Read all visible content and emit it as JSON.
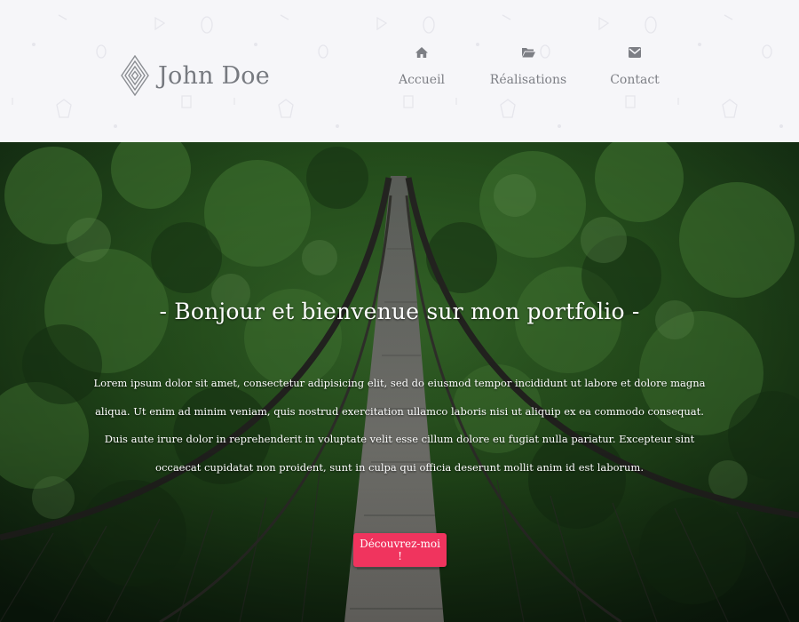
{
  "header": {
    "logo_text": "John Doe",
    "nav": [
      {
        "label": "Accueil",
        "icon": "home-icon"
      },
      {
        "label": "Réalisations",
        "icon": "folder-icon"
      },
      {
        "label": "Contact",
        "icon": "envelope-icon"
      }
    ]
  },
  "hero": {
    "title": "- Bonjour et bienvenue sur mon portfolio -",
    "text": "Lorem ipsum dolor sit amet, consectetur adipisicing elit, sed do eiusmod tempor incididunt ut labore et dolore magna aliqua. Ut enim ad minim veniam, quis nostrud exercitation ullamco laboris nisi ut aliquip ex ea commodo consequat. Duis aute irure dolor in reprehenderit in voluptate velit esse cillum dolore eu fugiat nulla pariatur. Excepteur sint occaecat cupidatat non proident, sunt in culpa qui officia deserunt mollit anim id est laborum.",
    "cta_label": "Découvrez-moi !"
  },
  "colors": {
    "accent": "#f0345e",
    "header_bg": "#f6f6f9",
    "nav_text": "#7d7f85",
    "forest": "#2c5a22"
  }
}
